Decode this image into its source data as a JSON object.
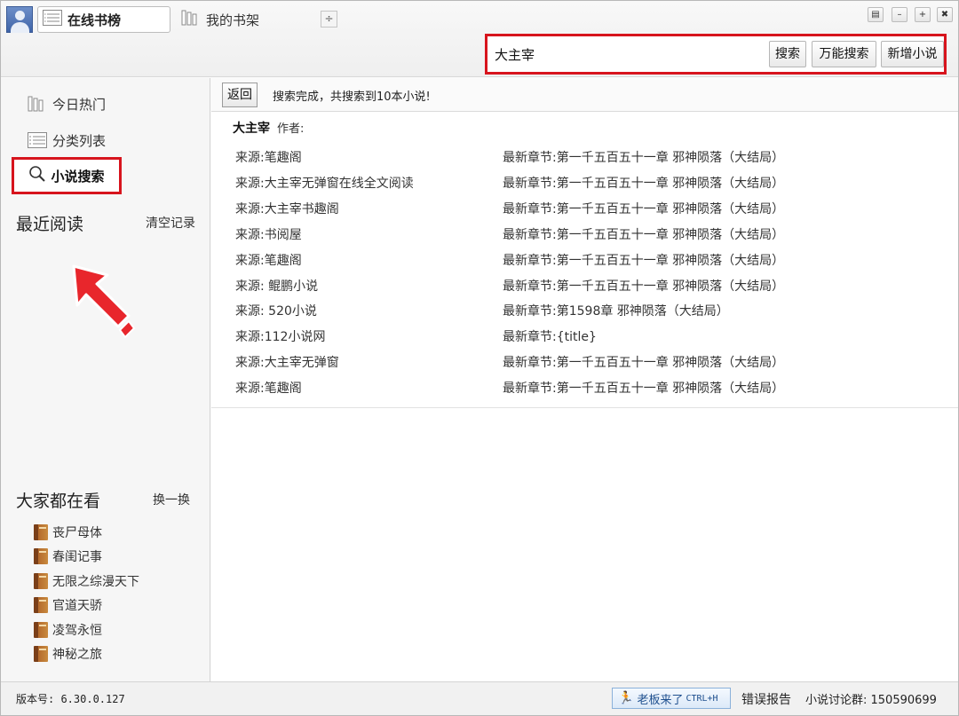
{
  "tabs": {
    "online_rank": "在线书榜",
    "my_shelf": "我的书架",
    "add_tab": "÷"
  },
  "window_controls": {
    "skin": "▤",
    "minimize": "–",
    "maximize": "+",
    "close": "✖"
  },
  "search": {
    "value": "大主宰",
    "search_btn": "搜索",
    "universal_btn": "万能搜索",
    "add_novel_btn": "新增小说"
  },
  "sidebar": {
    "today_hot": "今日热门",
    "category_list": "分类列表",
    "novel_search": "小说搜索",
    "recent_title": "最近阅读",
    "clear_record": "清空记录",
    "everyone_title": "大家都在看",
    "refresh": "换一换",
    "books": [
      "丧尸母体",
      "春闺记事",
      "无限之综漫天下",
      "官道天骄",
      "凌驾永恒",
      "神秘之旅"
    ]
  },
  "toolbar": {
    "back": "返回",
    "status": "搜索完成，共搜索到10本小说!"
  },
  "result": {
    "book_name": "大主宰",
    "author_label": "作者:",
    "rows": [
      {
        "source": "来源:笔趣阁",
        "chapter": "最新章节:第一千五百五十一章 邪神陨落（大结局）"
      },
      {
        "source": "来源:大主宰无弹窗在线全文阅读",
        "chapter": "最新章节:第一千五百五十一章 邪神陨落（大结局）"
      },
      {
        "source": "来源:大主宰书趣阁",
        "chapter": "最新章节:第一千五百五十一章 邪神陨落（大结局）"
      },
      {
        "source": "来源:书阅屋",
        "chapter": "最新章节:第一千五百五十一章 邪神陨落（大结局）"
      },
      {
        "source": "来源:笔趣阁",
        "chapter": "最新章节:第一千五百五十一章 邪神陨落（大结局）"
      },
      {
        "source": "来源: 鲲鹏小说",
        "chapter": "最新章节:第一千五百五十一章 邪神陨落（大结局）"
      },
      {
        "source": "来源: 520小说",
        "chapter": "最新章节:第1598章 邪神陨落（大结局）"
      },
      {
        "source": "来源:112小说网",
        "chapter": "最新章节:{title}"
      },
      {
        "source": "来源:大主宰无弹窗",
        "chapter": "最新章节:第一千五百五十一章 邪神陨落（大结局）"
      },
      {
        "source": "来源:笔趣阁",
        "chapter": "最新章节:第一千五百五十一章 邪神陨落（大结局）"
      }
    ]
  },
  "statusbar": {
    "version": "版本号: 6.30.0.127",
    "boss_key": "老板来了",
    "boss_shortcut": "CTRL+H",
    "error_report": "错误报告",
    "group": "小说讨论群: 150590699"
  },
  "colors": {
    "highlight_red": "#d7141d",
    "accent_blue": "#3f64a8"
  }
}
